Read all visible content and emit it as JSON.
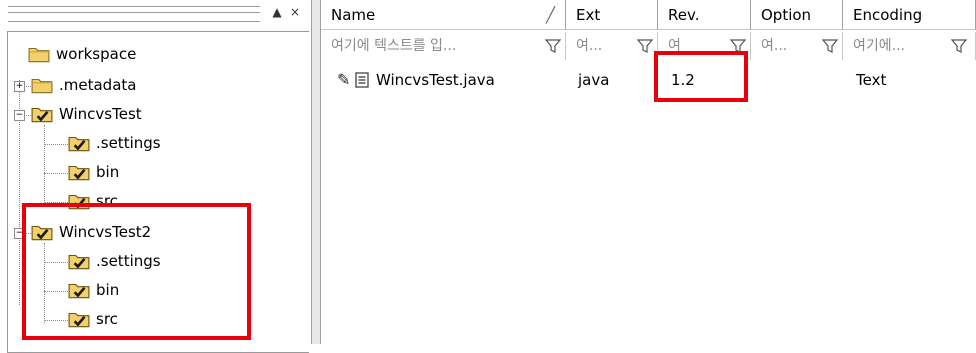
{
  "left_panel": {
    "toolbar": {
      "autohide_glyph": "▲",
      "close_glyph": "×"
    },
    "tree": {
      "root": "workspace",
      "metadata": ".metadata",
      "project1": {
        "label": "WincvsTest",
        "children": [
          ".settings",
          "bin",
          "src"
        ]
      },
      "project2": {
        "label": "WincvsTest2",
        "children": [
          ".settings",
          "bin",
          "src"
        ]
      }
    }
  },
  "file_list": {
    "columns": [
      "Name",
      "Ext",
      "Rev.",
      "Option",
      "Encoding"
    ],
    "sort_glyph": "╱",
    "filters": {
      "name": "여기에 텍스트를 입...",
      "ext": "여...",
      "rev": "여",
      "option": "여...",
      "encoding": "여기에..."
    },
    "rows": [
      {
        "name": "WincvsTest.java",
        "ext": "java",
        "rev": "1.2",
        "option": "",
        "encoding": "Text"
      }
    ]
  },
  "colors": {
    "highlight": "#e8000b",
    "folder": "#f2d16b"
  }
}
